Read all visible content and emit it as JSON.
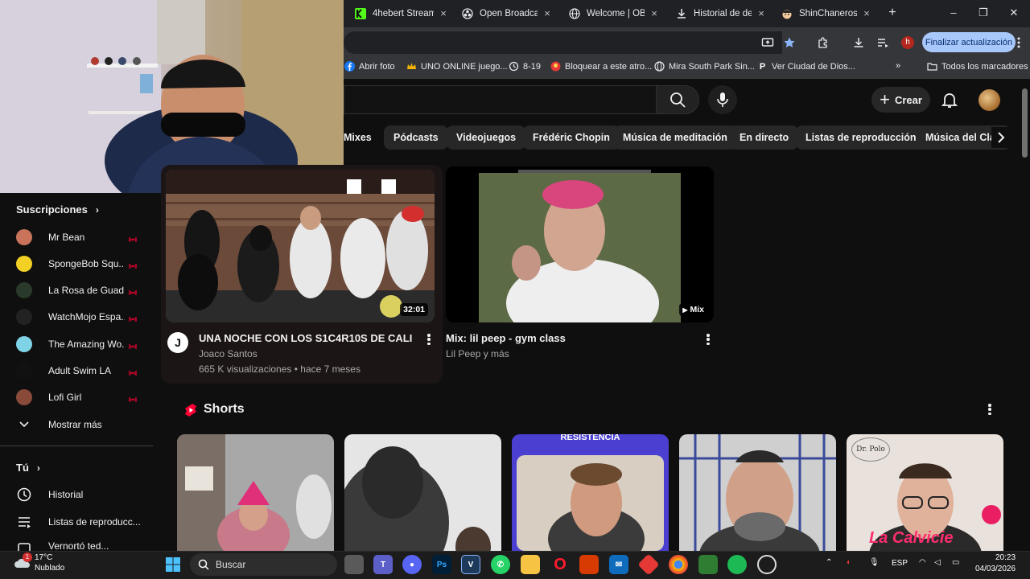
{
  "browser": {
    "tabs": [
      {
        "title": "4hebert Stream",
        "icon": "kick-icon"
      },
      {
        "title": "Open Broadcaste",
        "icon": "obs-icon"
      },
      {
        "title": "Welcome | OBS",
        "icon": "globe-icon"
      },
      {
        "title": "Historial de desc",
        "icon": "download-icon"
      },
      {
        "title": "ShinChaneros -",
        "icon": "shinchan-icon"
      }
    ],
    "update_label": "Finalizar actualización",
    "profile_letter": "h",
    "bookmarks": [
      {
        "label": "Abrir foto",
        "icon": "facebook-icon"
      },
      {
        "label": "UNO ONLINE juego...",
        "icon": "crown-icon"
      },
      {
        "label": "8-19",
        "icon": "history-icon"
      },
      {
        "label": "Bloquear a este atro...",
        "icon": "app-icon"
      },
      {
        "label": "Mira South Park Sin...",
        "icon": "globe-icon"
      },
      {
        "label": "Ver Ciudad de Dios...",
        "icon": "p-icon"
      }
    ],
    "all_bookmarks": "Todos los marcadores"
  },
  "youtube": {
    "create_label": "Crear",
    "chips": [
      "Mixes",
      "Pódcasts",
      "Videojuegos",
      "Frédéric Chopin",
      "Música de meditación",
      "En directo",
      "Listas de reproducción",
      "Música del Clas"
    ],
    "sidebar": {
      "subscriptions_heading": "Suscripciones",
      "subscriptions": [
        {
          "name": "Mr Bean",
          "color": "#c9745a"
        },
        {
          "name": "SpongeBob Squ...",
          "color": "#f2d024"
        },
        {
          "name": "La Rosa de Guad...",
          "color": "#2a3a2a"
        },
        {
          "name": "WatchMojo Espa...",
          "color": "#222222"
        },
        {
          "name": "The Amazing Wo...",
          "color": "#7fd3e6"
        },
        {
          "name": "Adult Swim LA",
          "color": "#111111"
        },
        {
          "name": "Lofi Girl",
          "color": "#8a4a3a"
        }
      ],
      "show_more": "Mostrar más",
      "you_heading": "Tú",
      "you_items": [
        "Historial",
        "Listas de reproducc...",
        "Vernortó ted..."
      ]
    },
    "videos": [
      {
        "title": "UNA NOCHE CON LOS S1C4R10S DE CALI",
        "channel": "Joaco Santos",
        "meta": "665 K visualizaciones • hace 7 meses",
        "duration": "32:01",
        "channel_initial": "J"
      },
      {
        "title": "Mix: lil peep - gym class",
        "channel": "Lil Peep y más",
        "badge": "Mix"
      }
    ],
    "shorts_heading": "Shorts",
    "shorts_texts": [
      "RESISTENCIA",
      "La Calvicie",
      "Dr. Polo"
    ]
  },
  "taskbar": {
    "weather_temp": "17°C",
    "weather_desc": "Nublado",
    "weather_badge": "1",
    "search_placeholder": "Buscar",
    "lang": "ESP",
    "time": "20:23",
    "date": "04/03/2026"
  }
}
